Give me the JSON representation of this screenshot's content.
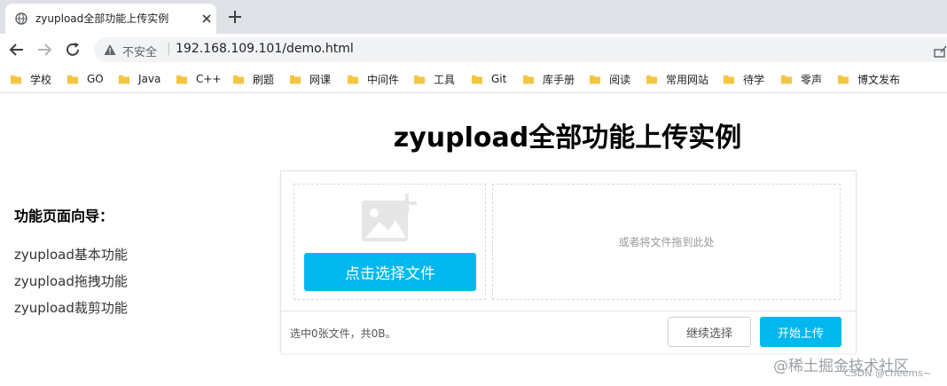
{
  "browser": {
    "tab_title": "zyupload全部功能上传实例",
    "security_label": "不安全",
    "separator": "|",
    "url": "192.168.109.101/demo.html"
  },
  "bookmarks": [
    {
      "label": "学校"
    },
    {
      "label": "GO"
    },
    {
      "label": "Java"
    },
    {
      "label": "C++"
    },
    {
      "label": "刷题"
    },
    {
      "label": "网课"
    },
    {
      "label": "中间件"
    },
    {
      "label": "工具"
    },
    {
      "label": "Git"
    },
    {
      "label": "库手册"
    },
    {
      "label": "阅读"
    },
    {
      "label": "常用网站"
    },
    {
      "label": "待学"
    },
    {
      "label": "零声"
    },
    {
      "label": "博文发布"
    }
  ],
  "page": {
    "title": "zyupload全部功能上传实例",
    "guide_title": "功能页面向导：",
    "guide_links": [
      "zyupload基本功能",
      "zyupload拖拽功能",
      "zyupload裁剪功能"
    ]
  },
  "uploader": {
    "select_button": "点击选择文件",
    "drop_hint": "或者将文件拖到此处",
    "status": "选中0张文件，共0B。",
    "continue_button": "继续选择",
    "start_button": "开始上传"
  },
  "watermark": {
    "main": "@稀土掘金技术社区",
    "sub": "CSDN @cheems~"
  },
  "colors": {
    "accent": "#00b7ee",
    "tabstrip": "#dee1e6",
    "folder": "#f5c542"
  }
}
